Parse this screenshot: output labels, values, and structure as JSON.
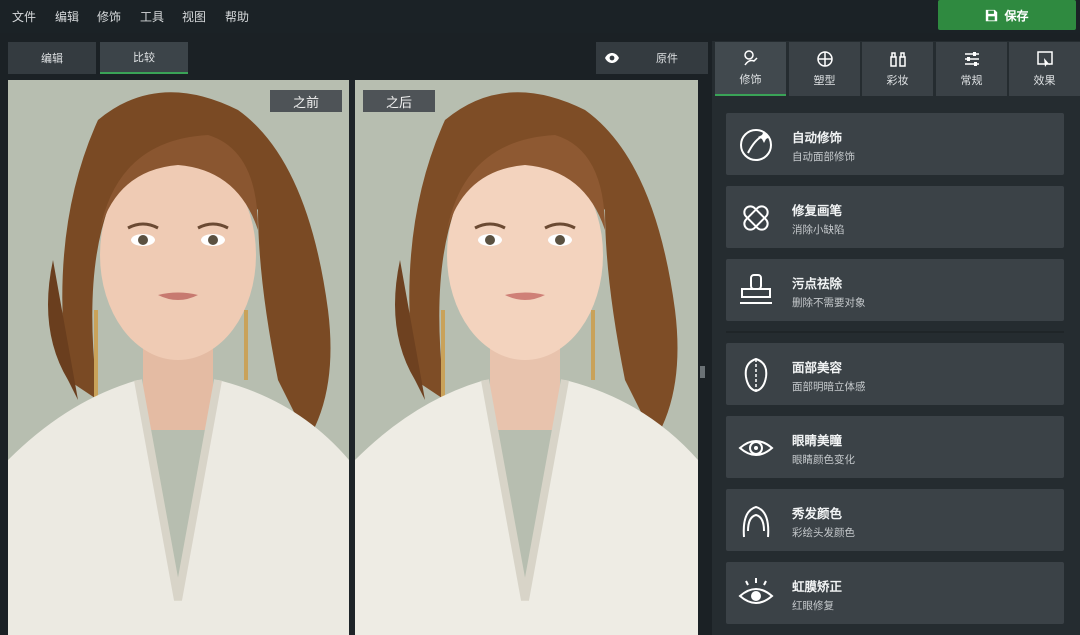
{
  "menu": [
    "文件",
    "编辑",
    "修饰",
    "工具",
    "视图",
    "帮助"
  ],
  "save_label": "保存",
  "mode_tabs": [
    "编辑",
    "比较"
  ],
  "original_label": "原件",
  "before_label": "之前",
  "after_label": "之后",
  "category_tabs": [
    "修饰",
    "塑型",
    "彩妆",
    "常规",
    "效果"
  ],
  "tools": [
    {
      "name": "自动修饰",
      "desc": "自动面部修饰",
      "icon": "auto-retouch-icon"
    },
    {
      "name": "修复画笔",
      "desc": "消除小缺陷",
      "icon": "healing-brush-icon"
    },
    {
      "name": "污点祛除",
      "desc": "删除不需要对象",
      "icon": "stamp-icon"
    },
    {
      "name": "面部美容",
      "desc": "面部明暗立体感",
      "icon": "face-contour-icon"
    },
    {
      "name": "眼睛美瞳",
      "desc": "眼睛颜色变化",
      "icon": "eye-color-icon"
    },
    {
      "name": "秀发颜色",
      "desc": "彩绘头发颜色",
      "icon": "hair-icon"
    },
    {
      "name": "虹膜矫正",
      "desc": "红眼修复",
      "icon": "iris-icon"
    }
  ],
  "colors": {
    "accent": "#3aa357",
    "save": "#2f8a40",
    "background": "#1b2125"
  }
}
